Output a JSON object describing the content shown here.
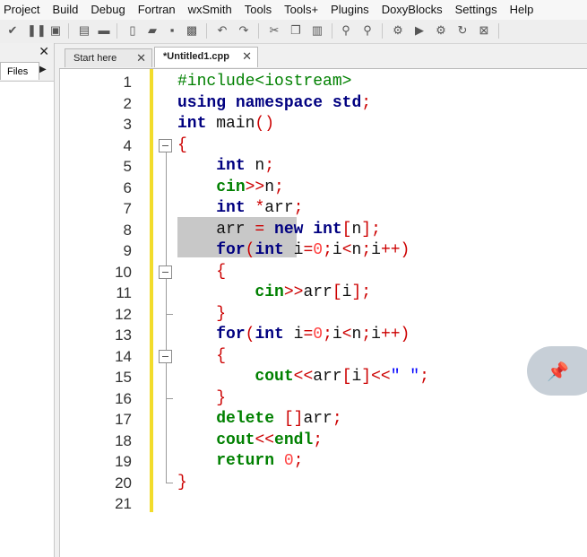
{
  "menu": {
    "items": [
      "Project",
      "Build",
      "Debug",
      "Fortran",
      "wxSmith",
      "Tools",
      "Tools+",
      "Plugins",
      "DoxyBlocks",
      "Settings",
      "Help"
    ]
  },
  "toolbar": {
    "icons": [
      "check-icon",
      "pause-icon",
      "stop-icon",
      "new-project-icon",
      "window-icon",
      "new-file-icon",
      "open-icon",
      "save-icon",
      "save-all-icon",
      "undo-icon",
      "redo-icon",
      "cut-icon",
      "copy-icon",
      "paste-icon",
      "find-icon",
      "replace-icon",
      "gear-icon",
      "run-icon",
      "build-run-icon",
      "rebuild-icon",
      "abort-icon"
    ]
  },
  "left_panel": {
    "close_glyph": "✕",
    "tab_label": "Files",
    "arrow_glyph": "▶"
  },
  "tabs": [
    {
      "label": "Start here",
      "close": "✕",
      "active": false
    },
    {
      "label": "*Untitled1.cpp",
      "close": "✕",
      "active": true
    }
  ],
  "editor": {
    "lines": [
      {
        "n": "1",
        "tokens": [
          [
            "pp",
            "#include<iostream>"
          ]
        ]
      },
      {
        "n": "2",
        "tokens": [
          [
            "kw",
            "using"
          ],
          [
            "plain",
            " "
          ],
          [
            "kw",
            "namespace"
          ],
          [
            "plain",
            " "
          ],
          [
            "kw",
            "std"
          ],
          [
            "op",
            ";"
          ]
        ]
      },
      {
        "n": "3",
        "tokens": [
          [
            "kw",
            "int"
          ],
          [
            "plain",
            " main"
          ],
          [
            "op",
            "()"
          ]
        ]
      },
      {
        "n": "4",
        "tokens": [
          [
            "op",
            "{"
          ]
        ]
      },
      {
        "n": "5",
        "tokens": [
          [
            "plain",
            "    "
          ],
          [
            "kw",
            "int"
          ],
          [
            "plain",
            " n"
          ],
          [
            "op",
            ";"
          ]
        ]
      },
      {
        "n": "6",
        "tokens": [
          [
            "plain",
            "    "
          ],
          [
            "kw2",
            "cin"
          ],
          [
            "op",
            ">>"
          ],
          [
            "plain",
            "n"
          ],
          [
            "op",
            ";"
          ]
        ]
      },
      {
        "n": "7",
        "tokens": [
          [
            "plain",
            "    "
          ],
          [
            "kw",
            "int"
          ],
          [
            "plain",
            " "
          ],
          [
            "op",
            "*"
          ],
          [
            "plain",
            "arr"
          ],
          [
            "op",
            ";"
          ]
        ]
      },
      {
        "n": "8",
        "tokens": [
          [
            "plain",
            "    arr "
          ],
          [
            "op",
            "="
          ],
          [
            "plain",
            " "
          ],
          [
            "kw",
            "new"
          ],
          [
            "plain",
            " "
          ],
          [
            "kw",
            "int"
          ],
          [
            "op",
            "["
          ],
          [
            "plain",
            "n"
          ],
          [
            "op",
            "];"
          ]
        ]
      },
      {
        "n": "9",
        "tokens": [
          [
            "plain",
            "    "
          ],
          [
            "kw",
            "for"
          ],
          [
            "op",
            "("
          ],
          [
            "kw",
            "int"
          ],
          [
            "plain",
            " i"
          ],
          [
            "op",
            "="
          ],
          [
            "num",
            "0"
          ],
          [
            "op",
            ";"
          ],
          [
            "plain",
            "i"
          ],
          [
            "op",
            "<"
          ],
          [
            "plain",
            "n"
          ],
          [
            "op",
            ";"
          ],
          [
            "plain",
            "i"
          ],
          [
            "op",
            "++)"
          ]
        ]
      },
      {
        "n": "10",
        "tokens": [
          [
            "plain",
            "    "
          ],
          [
            "op",
            "{"
          ]
        ]
      },
      {
        "n": "11",
        "tokens": [
          [
            "plain",
            "        "
          ],
          [
            "kw2",
            "cin"
          ],
          [
            "op",
            ">>"
          ],
          [
            "plain",
            "arr"
          ],
          [
            "op",
            "["
          ],
          [
            "plain",
            "i"
          ],
          [
            "op",
            "];"
          ]
        ]
      },
      {
        "n": "12",
        "tokens": [
          [
            "plain",
            "    "
          ],
          [
            "op",
            "}"
          ]
        ]
      },
      {
        "n": "13",
        "tokens": [
          [
            "plain",
            "    "
          ],
          [
            "kw",
            "for"
          ],
          [
            "op",
            "("
          ],
          [
            "kw",
            "int"
          ],
          [
            "plain",
            " i"
          ],
          [
            "op",
            "="
          ],
          [
            "num",
            "0"
          ],
          [
            "op",
            ";"
          ],
          [
            "plain",
            "i"
          ],
          [
            "op",
            "<"
          ],
          [
            "plain",
            "n"
          ],
          [
            "op",
            ";"
          ],
          [
            "plain",
            "i"
          ],
          [
            "op",
            "++)"
          ]
        ]
      },
      {
        "n": "14",
        "tokens": [
          [
            "plain",
            "    "
          ],
          [
            "op",
            "{"
          ]
        ]
      },
      {
        "n": "15",
        "tokens": [
          [
            "plain",
            "        "
          ],
          [
            "kw2",
            "cout"
          ],
          [
            "op",
            "<<"
          ],
          [
            "plain",
            "arr"
          ],
          [
            "op",
            "["
          ],
          [
            "plain",
            "i"
          ],
          [
            "op",
            "]<<"
          ],
          [
            "str",
            "\" \""
          ],
          [
            "op",
            ";"
          ]
        ]
      },
      {
        "n": "16",
        "tokens": [
          [
            "plain",
            "    "
          ],
          [
            "op",
            "}"
          ]
        ]
      },
      {
        "n": "17",
        "tokens": [
          [
            "plain",
            "    "
          ],
          [
            "kw2",
            "delete"
          ],
          [
            "plain",
            " "
          ],
          [
            "op",
            "[]"
          ],
          [
            "plain",
            "arr"
          ],
          [
            "op",
            ";"
          ]
        ]
      },
      {
        "n": "18",
        "tokens": [
          [
            "plain",
            "    "
          ],
          [
            "kw2",
            "cout"
          ],
          [
            "op",
            "<<"
          ],
          [
            "kw2",
            "endl"
          ],
          [
            "op",
            ";"
          ]
        ]
      },
      {
        "n": "19",
        "tokens": [
          [
            "plain",
            "    "
          ],
          [
            "kw2",
            "return"
          ],
          [
            "plain",
            " "
          ],
          [
            "num",
            "0"
          ],
          [
            "op",
            ";"
          ]
        ]
      },
      {
        "n": "20",
        "tokens": [
          [
            "op",
            "}"
          ]
        ]
      },
      {
        "n": "21",
        "tokens": []
      }
    ]
  },
  "pin": {
    "icon": "pushpin-icon"
  }
}
